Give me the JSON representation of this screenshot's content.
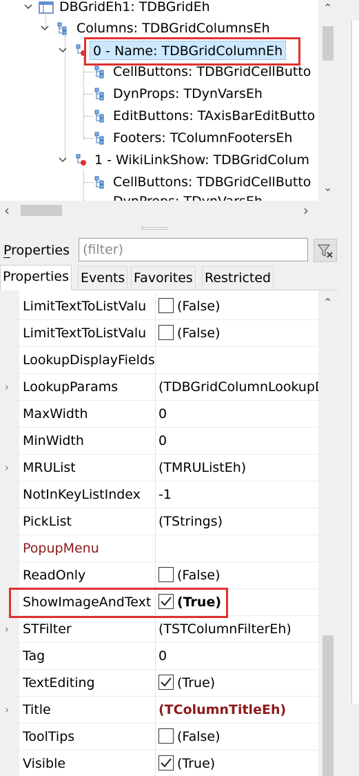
{
  "tree": {
    "nodes": [
      {
        "label": "DBGridEh1: TDBGridEh"
      },
      {
        "label": "Columns: TDBGridColumnsEh"
      },
      {
        "label": "0 - Name: TDBGridColumnEh"
      },
      {
        "label": "CellButtons: TDBGridCellButto"
      },
      {
        "label": "DynProps: TDynVarsEh"
      },
      {
        "label": "EditButtons: TAxisBarEditButto"
      },
      {
        "label": "Footers: TColumnFootersEh"
      },
      {
        "label": "1 - WikiLinkShow: TDBGridColum"
      },
      {
        "label": "CellButtons: TDBGridCellButto"
      },
      {
        "label": "DynProps: TDynVarsEh"
      }
    ]
  },
  "filter": {
    "label": "Properties",
    "placeholder": "(filter)"
  },
  "tabs": [
    {
      "label": "Properties"
    },
    {
      "label": "Events"
    },
    {
      "label": "Favorites"
    },
    {
      "label": "Restricted"
    }
  ],
  "properties": [
    {
      "name": "LimitTextToListValu",
      "value": "(False)"
    },
    {
      "name": "LimitTextToListValu",
      "value": "(False)"
    },
    {
      "name": "LookupDisplayFields",
      "value": ""
    },
    {
      "name": "LookupParams",
      "value": "(TDBGridColumnLookupDa"
    },
    {
      "name": "MaxWidth",
      "value": "0"
    },
    {
      "name": "MinWidth",
      "value": "0"
    },
    {
      "name": "MRUList",
      "value": "(TMRUListEh)"
    },
    {
      "name": "NotInKeyListIndex",
      "value": "-1"
    },
    {
      "name": "PickList",
      "value": "(TStrings)"
    },
    {
      "name": "PopupMenu",
      "value": ""
    },
    {
      "name": "ReadOnly",
      "value": "(False)"
    },
    {
      "name": "ShowImageAndText",
      "value": "(True)"
    },
    {
      "name": "STFilter",
      "value": "(TSTColumnFilterEh)"
    },
    {
      "name": "Tag",
      "value": "0"
    },
    {
      "name": "TextEditing",
      "value": "(True)"
    },
    {
      "name": "Title",
      "value": "(TColumnTitleEh)"
    },
    {
      "name": "ToolTips",
      "value": "(False)"
    },
    {
      "name": "Visible",
      "value": "(True)"
    }
  ],
  "colors": {
    "highlight_box": "#e03030",
    "selected_node_bg": "#cce8ff",
    "reference_text": "#8b1a1a"
  }
}
